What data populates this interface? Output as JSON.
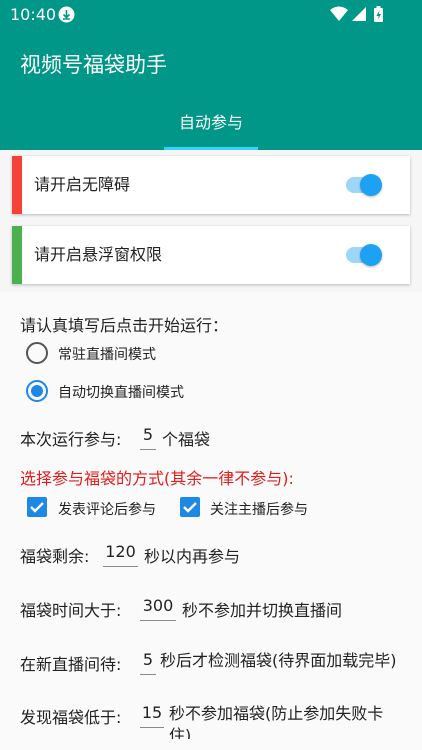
{
  "status_bar": {
    "time": "10:40",
    "icons": [
      "download-icon",
      "wifi-icon",
      "signal-icon",
      "battery-charging-icon"
    ]
  },
  "app_bar": {
    "title": "视频号福袋助手",
    "tab_label": "自动参与",
    "tab_indicator_color": "#37d0ff",
    "background": "#009688"
  },
  "permissions": [
    {
      "label": "请开启无障碍",
      "stripe_color": "#f44336",
      "enabled": true
    },
    {
      "label": "请开启悬浮窗权限",
      "stripe_color": "#4caf50",
      "enabled": true
    }
  ],
  "settings": {
    "intro": "请认真填写后点击开始运行：",
    "modes": [
      {
        "label": "常驻直播间模式",
        "selected": false
      },
      {
        "label": "自动切换直播间模式",
        "selected": true
      }
    ],
    "run_count": {
      "prefix": "本次运行参与:",
      "value": "5",
      "suffix": "个福袋"
    },
    "method_hint": "选择参与福袋的方式(其余一律不参与):",
    "methods": [
      {
        "label": "发表评论后参与",
        "checked": true
      },
      {
        "label": "关注主播后参与",
        "checked": true
      }
    ],
    "remaining": {
      "prefix": "福袋剩余:",
      "value": "120",
      "suffix": "秒以内再参与"
    },
    "duration": {
      "prefix": "福袋时间大于:",
      "value": "300",
      "suffix": "秒不参加并切换直播间"
    },
    "wait": {
      "prefix": "在新直播间待:",
      "value": "5",
      "suffix": "秒后才检测福袋(待界面加载完毕)"
    },
    "min_time": {
      "prefix": "发现福袋低于:",
      "value": "15",
      "suffix": "秒不参加福袋(防止参加失败卡住)"
    }
  }
}
